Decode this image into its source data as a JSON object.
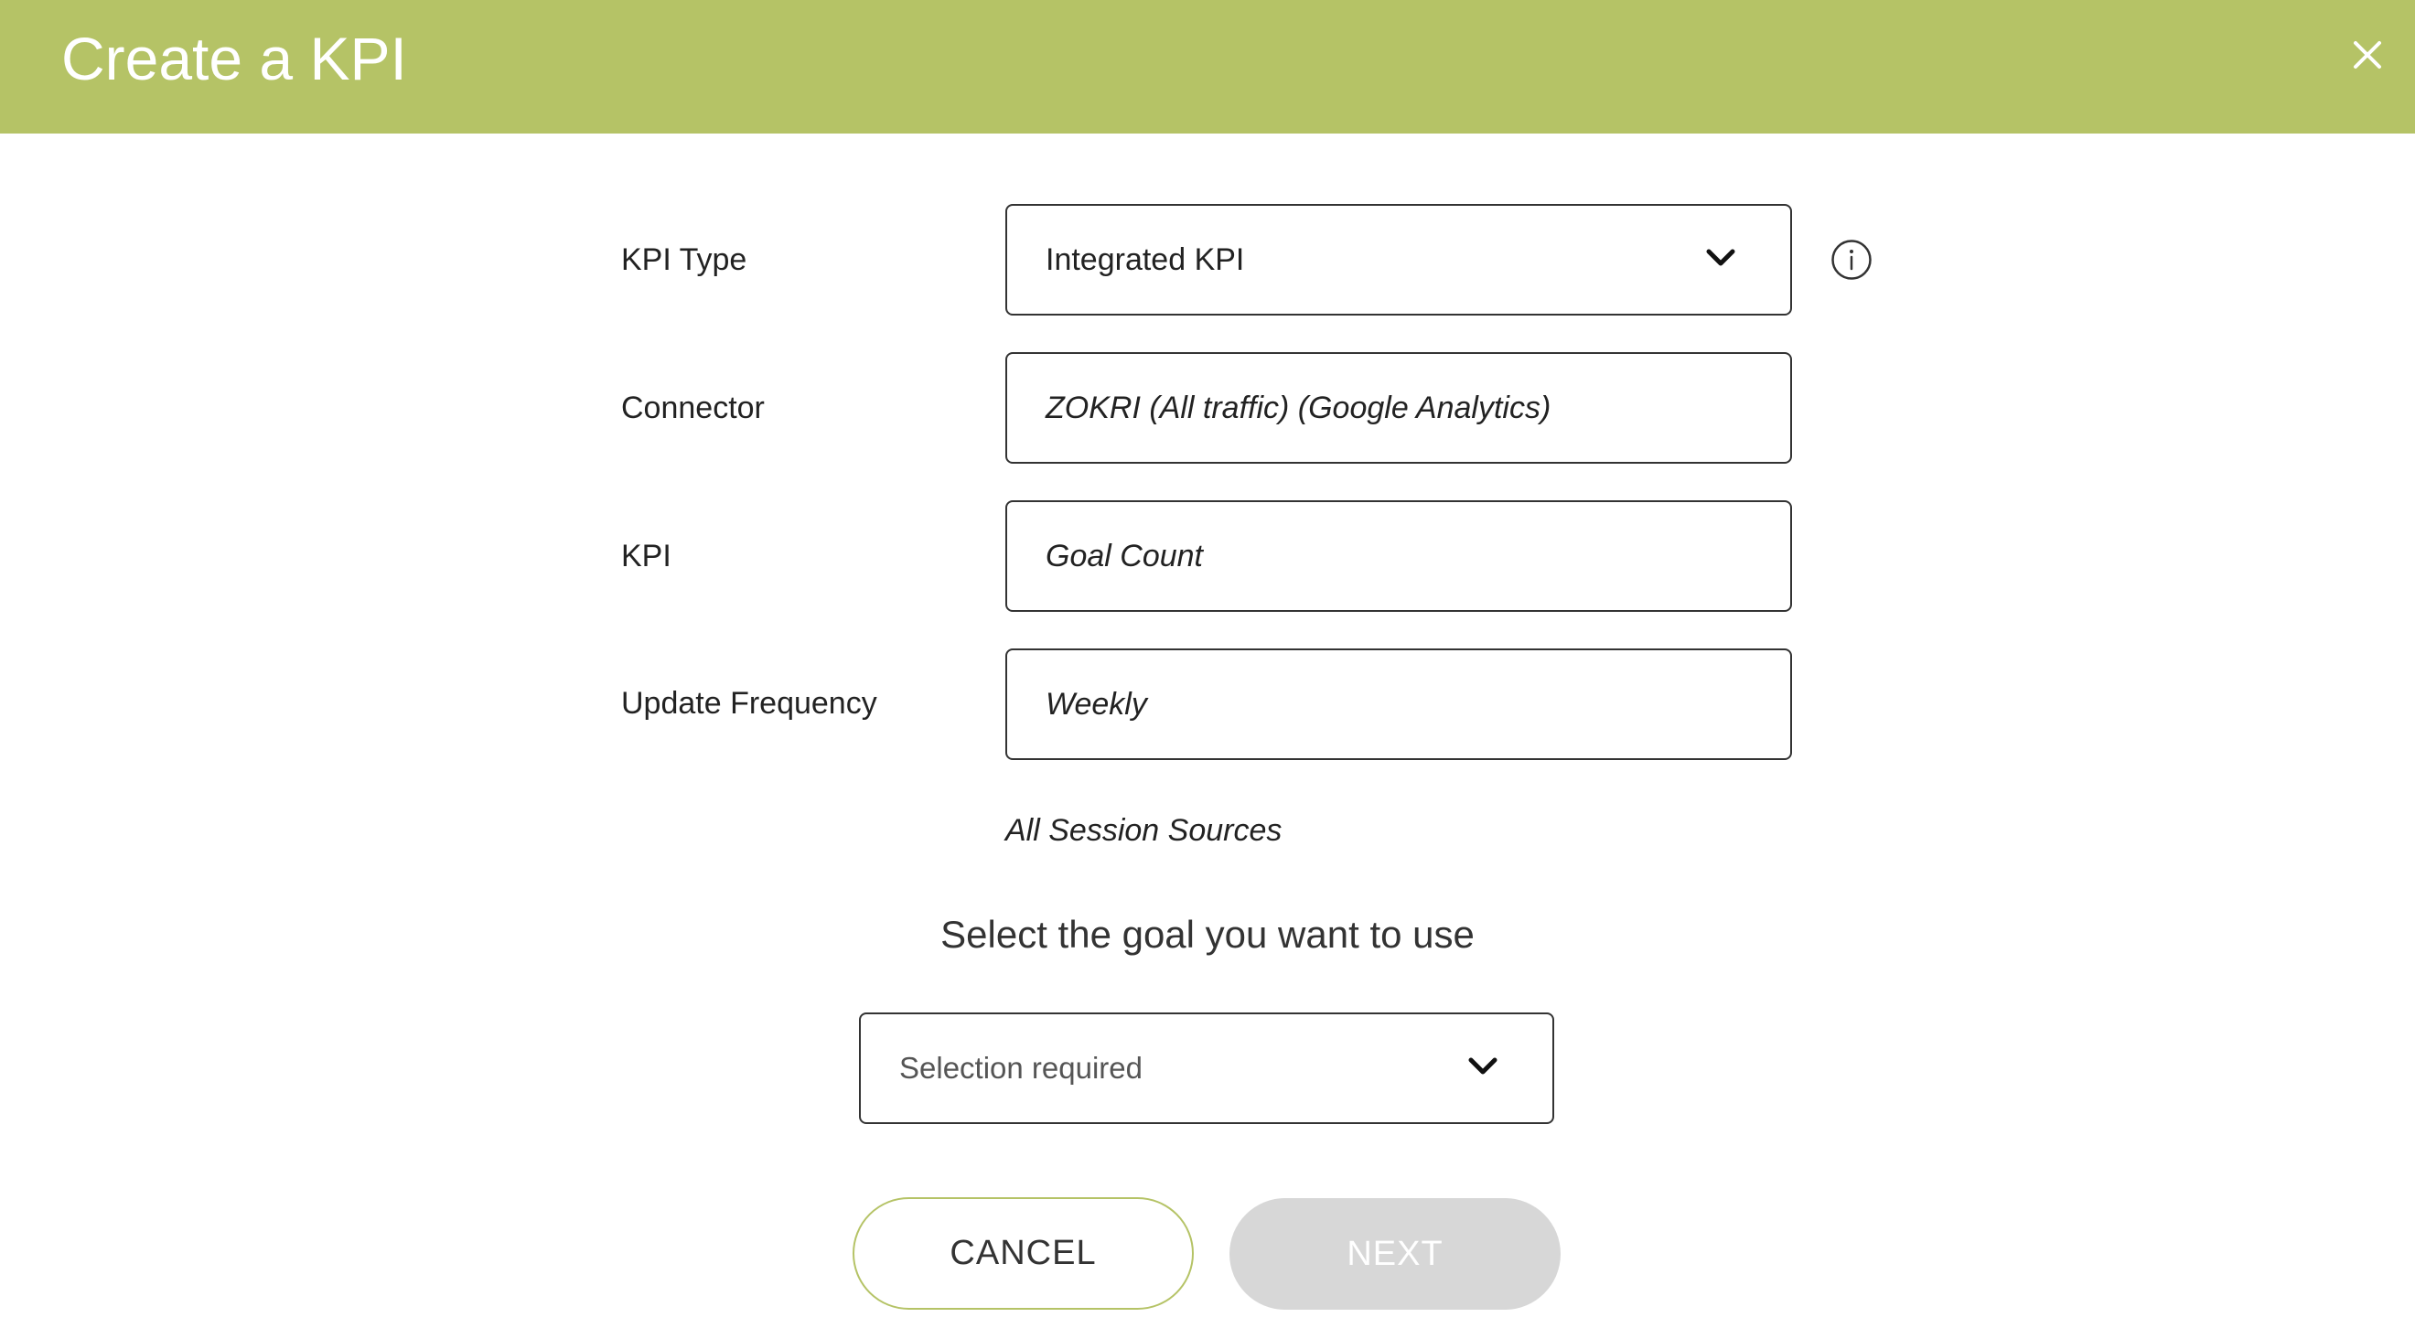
{
  "header": {
    "title": "Create a KPI",
    "background_color": "#b5c366",
    "close_icon": "close-icon"
  },
  "form": {
    "kpi_type": {
      "label": "KPI Type",
      "value": "Integrated KPI"
    },
    "connector": {
      "label": "Connector",
      "value": "ZOKRI (All traffic) (Google Analytics)"
    },
    "kpi": {
      "label": "KPI",
      "value": "Goal Count"
    },
    "update_frequency": {
      "label": "Update Frequency",
      "value": "Weekly"
    },
    "sub_note": "All Session Sources"
  },
  "goal": {
    "heading": "Select the goal you want to use",
    "placeholder": "Selection required"
  },
  "actions": {
    "cancel_label": "CANCEL",
    "next_label": "NEXT",
    "cancel_border_color": "#b5c366",
    "next_disabled_color": "#d7d7d7"
  }
}
